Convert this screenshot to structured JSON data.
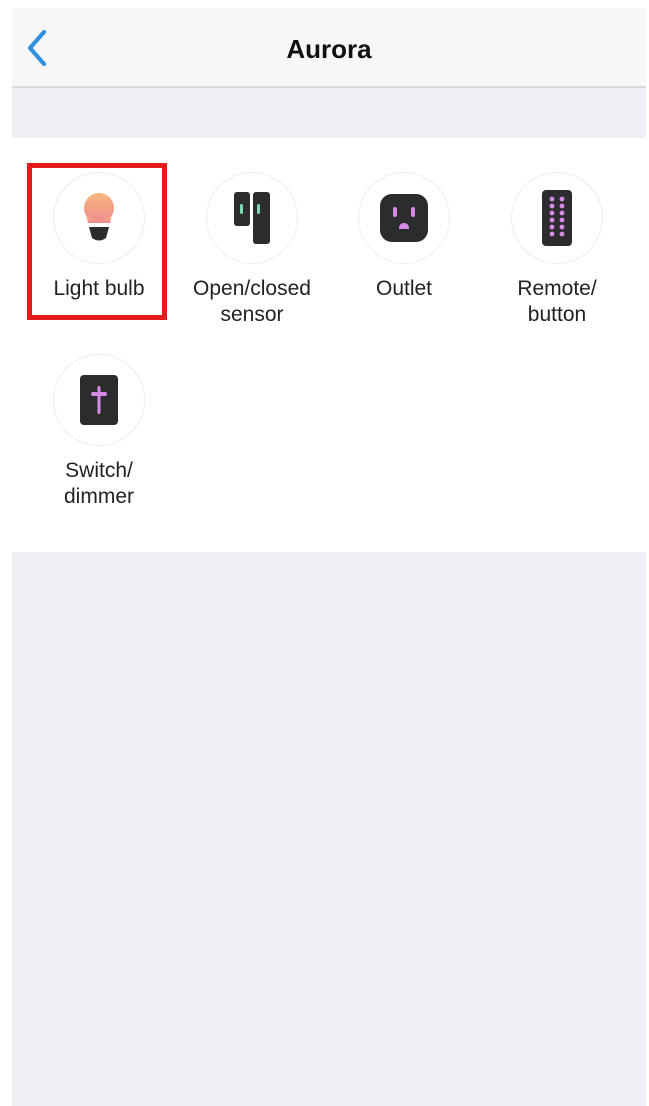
{
  "app": {
    "title": "Aurora"
  },
  "navbar": {
    "back_icon": "chevron-left-icon",
    "accent_color": "#2f8fde"
  },
  "device_types": [
    {
      "label": "Light bulb",
      "icon": "light-bulb-icon"
    },
    {
      "label": "Open/closed\nsensor",
      "icon": "door-sensor-icon"
    },
    {
      "label": "Outlet",
      "icon": "outlet-icon"
    },
    {
      "label": "Remote/\nbutton",
      "icon": "remote-icon"
    },
    {
      "label": "Switch/\ndimmer",
      "icon": "switch-icon"
    }
  ],
  "highlight": {
    "target": "Light bulb",
    "color": "#e31b1b"
  }
}
